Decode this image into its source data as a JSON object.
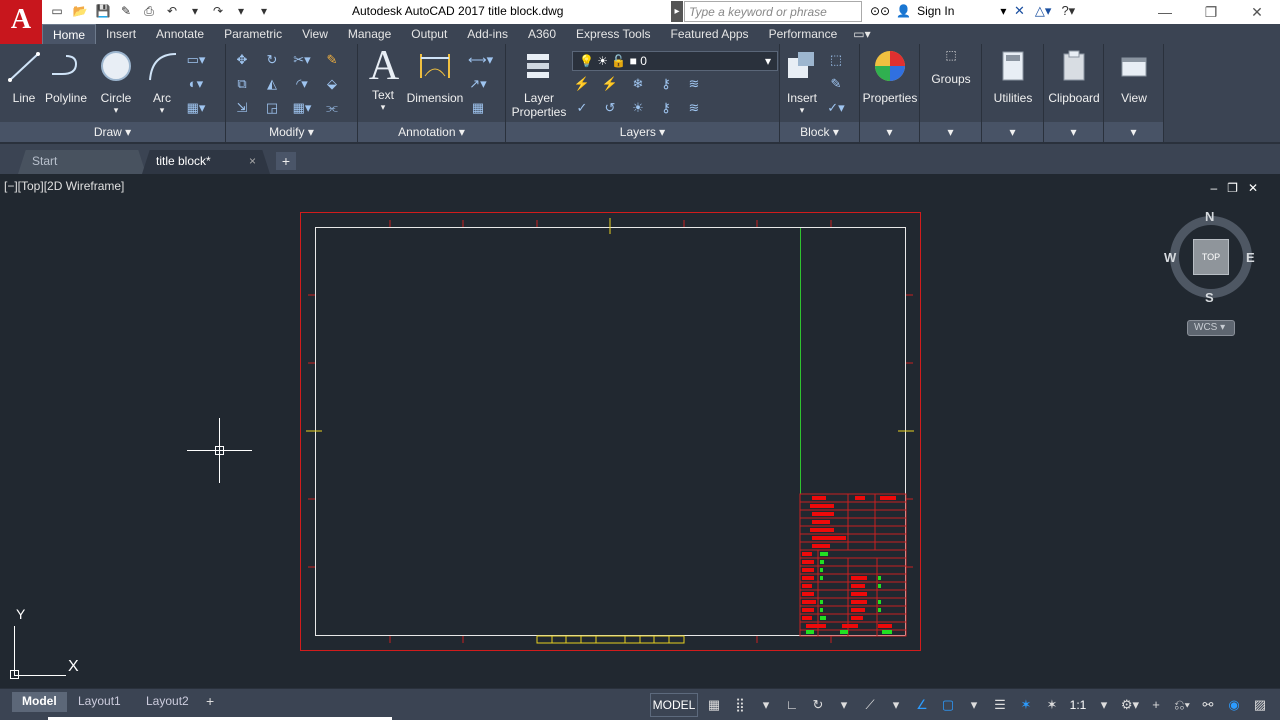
{
  "titlebar": {
    "app_logo": "A",
    "title": "Autodesk AutoCAD 2017    title block.dwg",
    "search_placeholder": "Type a keyword or phrase",
    "sign_in": "Sign In",
    "qat_icons": [
      "new-icon",
      "open-icon",
      "save-icon",
      "save-as-icon",
      "print-icon",
      "undo-icon",
      "redo-icon"
    ]
  },
  "ribbon_tabs": [
    "Home",
    "Insert",
    "Annotate",
    "Parametric",
    "View",
    "Manage",
    "Output",
    "Add-ins",
    "A360",
    "Express Tools",
    "Featured Apps",
    "Performance"
  ],
  "panels": {
    "draw": {
      "title": "Draw",
      "buttons": [
        "Line",
        "Polyline",
        "Circle",
        "Arc"
      ]
    },
    "modify": {
      "title": "Modify"
    },
    "annotation": {
      "title": "Annotation",
      "buttons": [
        "Text",
        "Dimension"
      ]
    },
    "layers": {
      "title": "Layers",
      "layer_properties": "Layer\nProperties",
      "current_layer": "0"
    },
    "block": {
      "title": "Block",
      "insert": "Insert"
    },
    "properties": {
      "label": "Properties"
    },
    "groups": {
      "label": "Groups"
    },
    "utilities": {
      "label": "Utilities"
    },
    "clipboard": {
      "label": "Clipboard"
    },
    "view": {
      "label": "View"
    }
  },
  "doc_tabs": {
    "start": "Start",
    "active": "title block*",
    "close": "×",
    "add": "+"
  },
  "viewport": {
    "label": "[−][Top][2D Wireframe]"
  },
  "viewcube": {
    "n": "N",
    "s": "S",
    "e": "E",
    "w": "W",
    "top": "TOP",
    "wcs": "WCS"
  },
  "ucs": {
    "x": "X",
    "y": "Y"
  },
  "layouts": [
    "Model",
    "Layout1",
    "Layout2"
  ],
  "status": {
    "model": "MODEL",
    "scale": "1:1"
  }
}
